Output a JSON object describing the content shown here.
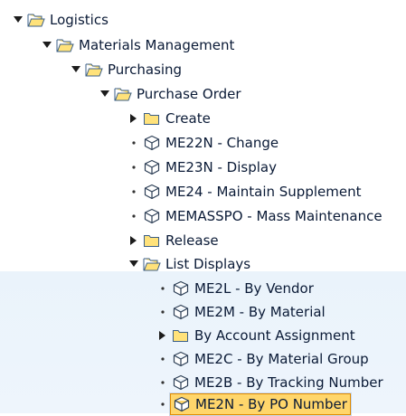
{
  "icons": {
    "expanded": "triangle-down-icon",
    "collapsed": "triangle-right-icon",
    "leaf": "bullet-icon",
    "folder_open": "open-folder-icon",
    "folder_closed": "closed-folder-icon",
    "transaction": "cube-transaction-icon"
  },
  "colors": {
    "folder_fill": "#ffe27a",
    "folder_stroke": "#3b5f88",
    "selection_fill": "#ffd66b",
    "selection_border": "#e08a00",
    "lower_band": "#eaf3fb"
  },
  "tree": [
    {
      "label": "Logistics",
      "level": 0,
      "state": "expanded",
      "icon": "folder_open"
    },
    {
      "label": "Materials Management",
      "level": 1,
      "state": "expanded",
      "icon": "folder_open"
    },
    {
      "label": "Purchasing",
      "level": 2,
      "state": "expanded",
      "icon": "folder_open"
    },
    {
      "label": "Purchase Order",
      "level": 3,
      "state": "expanded",
      "icon": "folder_open"
    },
    {
      "label": "Create",
      "level": 4,
      "state": "collapsed",
      "icon": "folder_closed"
    },
    {
      "label": "ME22N - Change",
      "level": 4,
      "state": "leaf",
      "icon": "transaction"
    },
    {
      "label": "ME23N - Display",
      "level": 4,
      "state": "leaf",
      "icon": "transaction"
    },
    {
      "label": "ME24 - Maintain Supplement",
      "level": 4,
      "state": "leaf",
      "icon": "transaction"
    },
    {
      "label": "MEMASSPO - Mass Maintenance",
      "level": 4,
      "state": "leaf",
      "icon": "transaction"
    },
    {
      "label": "Release",
      "level": 4,
      "state": "collapsed",
      "icon": "folder_closed"
    },
    {
      "label": "List Displays",
      "level": 4,
      "state": "expanded",
      "icon": "folder_open"
    },
    {
      "label": "ME2L - By Vendor",
      "level": 5,
      "state": "leaf",
      "icon": "transaction"
    },
    {
      "label": "ME2M - By Material",
      "level": 5,
      "state": "leaf",
      "icon": "transaction"
    },
    {
      "label": "By Account Assignment",
      "level": 5,
      "state": "collapsed",
      "icon": "folder_closed"
    },
    {
      "label": "ME2C - By Material Group",
      "level": 5,
      "state": "leaf",
      "icon": "transaction"
    },
    {
      "label": "ME2B - By Tracking Number",
      "level": 5,
      "state": "leaf",
      "icon": "transaction"
    },
    {
      "label": "ME2N - By PO Number",
      "level": 5,
      "state": "leaf",
      "icon": "transaction",
      "selected": true
    }
  ]
}
